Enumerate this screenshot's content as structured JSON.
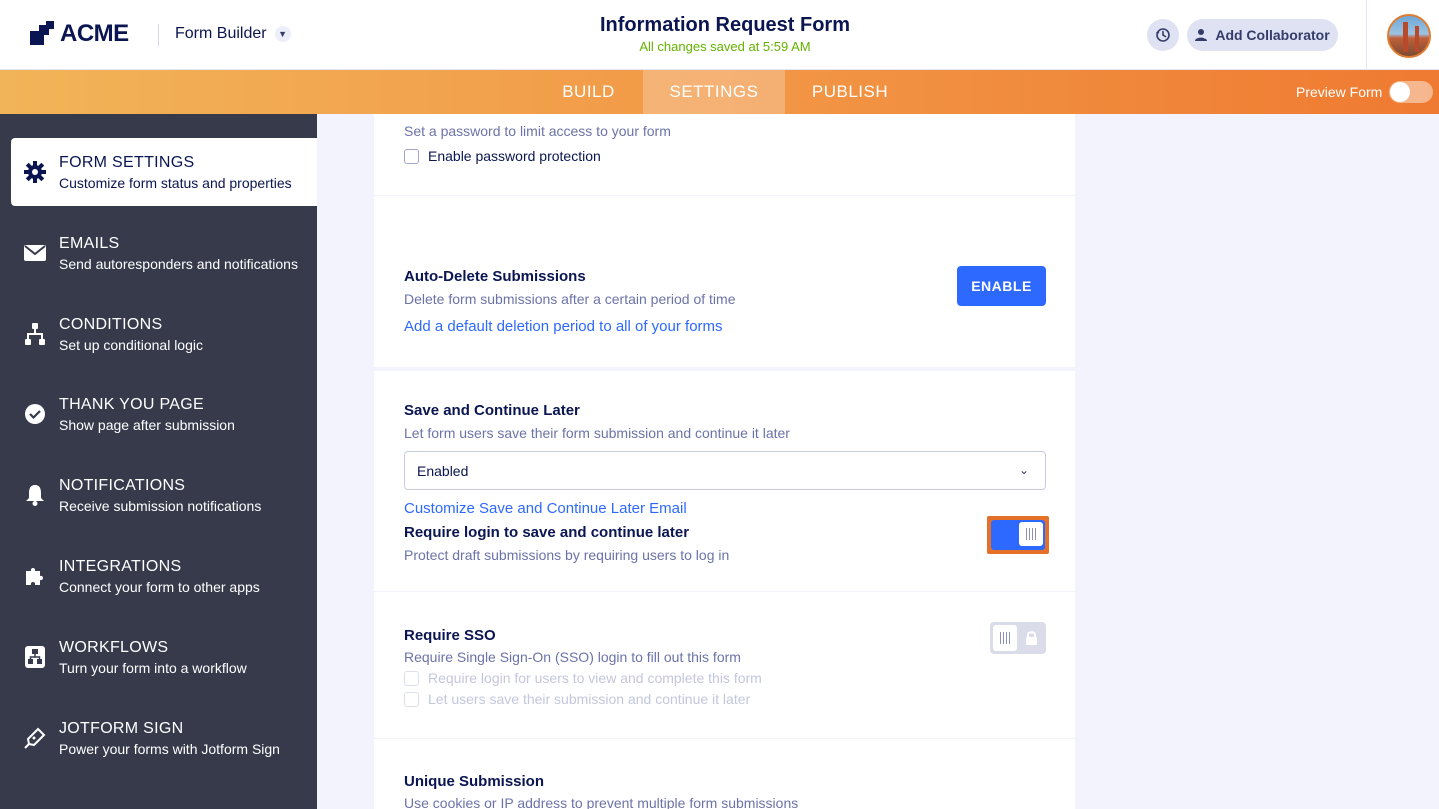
{
  "header": {
    "logo_text": "ACME",
    "builder_label": "Form Builder",
    "form_title": "Information Request Form",
    "saved_status": "All changes saved at 5:59 AM",
    "collaborator_label": "Add Collaborator"
  },
  "tabs": [
    {
      "label": "BUILD",
      "active": false
    },
    {
      "label": "SETTINGS",
      "active": true
    },
    {
      "label": "PUBLISH",
      "active": false
    }
  ],
  "preview": {
    "label": "Preview Form",
    "on": false
  },
  "sidebar": {
    "items": [
      {
        "label": "FORM SETTINGS",
        "sub": "Customize form status and properties",
        "icon": "gear-icon",
        "active": true
      },
      {
        "label": "EMAILS",
        "sub": "Send autoresponders and notifications",
        "icon": "envelope-icon",
        "active": false
      },
      {
        "label": "CONDITIONS",
        "sub": "Set up conditional logic",
        "icon": "hierarchy-icon",
        "active": false
      },
      {
        "label": "THANK YOU PAGE",
        "sub": "Show page after submission",
        "icon": "check-circle-icon",
        "active": false
      },
      {
        "label": "NOTIFICATIONS",
        "sub": "Receive submission notifications",
        "icon": "bell-icon",
        "active": false
      },
      {
        "label": "INTEGRATIONS",
        "sub": "Connect your form to other apps",
        "icon": "puzzle-icon",
        "active": false
      },
      {
        "label": "WORKFLOWS",
        "sub": "Turn your form into a workflow",
        "icon": "workflow-icon",
        "active": false
      },
      {
        "label": "JOTFORM SIGN",
        "sub": "Power your forms with Jotform Sign",
        "icon": "pen-icon",
        "active": false
      }
    ]
  },
  "password": {
    "sub": "Set a password to limit access to your form",
    "checkbox_label": "Enable password protection"
  },
  "auto_delete": {
    "title": "Auto-Delete Submissions",
    "sub": "Delete form submissions after a certain period of time",
    "link": "Add a default deletion period to all of your forms",
    "button": "ENABLE"
  },
  "save_continue": {
    "title": "Save and Continue Later",
    "sub": "Let form users save their form submission and continue it later",
    "select_value": "Enabled",
    "link": "Customize Save and Continue Later Email",
    "login_title": "Require login to save and continue later",
    "login_sub": "Protect draft submissions by requiring users to log in",
    "login_on": true
  },
  "sso": {
    "title": "Require SSO",
    "sub": "Require Single Sign-On (SSO) login to fill out this form",
    "option1": "Require login for users to view and complete this form",
    "option2": "Let users save their submission and continue it later"
  },
  "unique": {
    "title": "Unique Submission",
    "sub": "Use cookies or IP address to prevent multiple form submissions"
  },
  "colors": {
    "accent": "#2e69ff",
    "navy": "#0a1551",
    "sidebar": "#363a4b",
    "orange": "#ef7a31",
    "saved_green": "#64b200"
  }
}
